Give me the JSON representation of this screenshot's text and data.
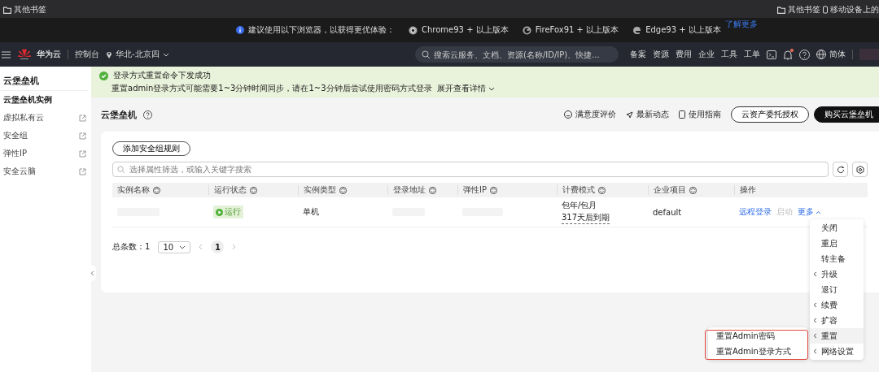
{
  "browser_bar": {
    "bookmarks_left": [
      "其他书签"
    ],
    "bookmarks_right": [
      {
        "label": "其他书签",
        "kind": "folder"
      },
      {
        "label": "移动设备上的",
        "kind": "phone"
      }
    ]
  },
  "notice": {
    "text": "建议使用以下浏览器，以获得更优体验：",
    "browsers": [
      {
        "label": "Chrome93 + 以上版本",
        "kind": "chrome"
      },
      {
        "label": "FireFox91 + 以上版本",
        "kind": "firefox"
      },
      {
        "label": "Edge93 + 以上版本",
        "kind": "edge"
      }
    ],
    "link": "了解更多"
  },
  "nav": {
    "brand": "华为云",
    "console": "控制台",
    "region": "华北-北京四",
    "search": {
      "placeholder": "搜索云服务、文档、资源(名称/ID/IP)、快捷..."
    },
    "links": [
      "备案",
      "资源",
      "费用",
      "企业",
      "工具",
      "工单"
    ],
    "language": "简体",
    "unread": true
  },
  "sidebar": {
    "title": "云堡垒机",
    "items": [
      {
        "label": "云堡垒机实例",
        "selected": true,
        "external": false
      },
      {
        "label": "虚拟私有云",
        "selected": false,
        "external": true
      },
      {
        "label": "安全组",
        "selected": false,
        "external": true
      },
      {
        "label": "弹性IP",
        "selected": false,
        "external": true
      },
      {
        "label": "安全云脑",
        "selected": false,
        "external": true
      }
    ]
  },
  "banner": {
    "title": "登录方式重置命令下发成功",
    "detail": "重置admin登录方式可能需要1~3分钟时间同步，请在1~3分钟后尝试使用密码方式登录",
    "expand": "展开查看详情"
  },
  "page": {
    "title": "云堡垒机",
    "actions": [
      {
        "label": "满意度评价",
        "kind": "smile"
      },
      {
        "label": "最新动态",
        "kind": "send"
      },
      {
        "label": "使用指南",
        "kind": "doc"
      }
    ],
    "buttons": [
      {
        "label": "云资产委托授权",
        "primary": false
      },
      {
        "label": "购买云堡垒机",
        "primary": true
      }
    ]
  },
  "toolbar": {
    "add_button": "添加安全组规则",
    "filter": {
      "placeholder": "选择属性筛选，或输入关键字搜索"
    }
  },
  "table": {
    "columns": [
      {
        "label": "实例名称",
        "sortable": true
      },
      {
        "label": "运行状态",
        "sortable": true
      },
      {
        "label": "实例类型",
        "sortable": true
      },
      {
        "label": "登录地址",
        "sortable": true
      },
      {
        "label": "弹性IP",
        "sortable": true
      },
      {
        "label": "计费模式",
        "sortable": true
      },
      {
        "label": "企业项目",
        "sortable": true
      },
      {
        "label": "操作",
        "sortable": false
      }
    ],
    "rows": [
      {
        "status": "运行",
        "type": "单机",
        "billing": "包年/包月",
        "expiry": "317天后到期",
        "project": "default",
        "ops": [
          {
            "label": "远程登录",
            "disabled": false
          },
          {
            "label": "启动",
            "disabled": true
          }
        ],
        "more": "更多"
      }
    ]
  },
  "pagination": {
    "total": "总条数：1",
    "page_size": "10",
    "pages": [
      {
        "label": "1",
        "selected": true
      }
    ]
  },
  "more_menu": {
    "items": [
      {
        "label": "关闭",
        "kind": "plain",
        "hovered": false
      },
      {
        "label": "重启",
        "kind": "plain",
        "hovered": false
      },
      {
        "label": "转主备",
        "kind": "plain",
        "hovered": false
      },
      {
        "label": "升级",
        "kind": "submenu",
        "hovered": false
      },
      {
        "label": "退订",
        "kind": "plain",
        "hovered": false
      },
      {
        "label": "续费",
        "kind": "submenu",
        "hovered": false
      },
      {
        "label": "扩容",
        "kind": "submenu",
        "hovered": false
      },
      {
        "label": "重置",
        "kind": "submenu",
        "hovered": true
      },
      {
        "label": "网络设置",
        "kind": "submenu",
        "hovered": false
      }
    ],
    "submenu": {
      "items": [
        "重置Admin密码",
        "重置Admin登录方式"
      ],
      "highlighted": true
    }
  }
}
